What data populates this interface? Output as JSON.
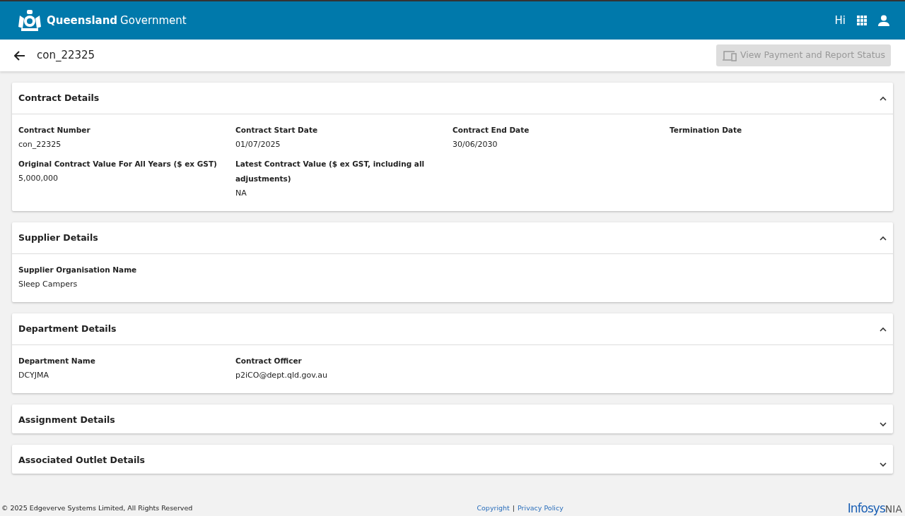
{
  "header": {
    "brand_bold": "Queensland",
    "brand_light": "Government",
    "greeting": "Hi"
  },
  "toolbar": {
    "title": "con_22325",
    "action": {
      "label": "View Payment and Report Status",
      "disabled": true
    }
  },
  "sections": [
    {
      "title": "Contract Details",
      "expanded": true,
      "fields": [
        {
          "label": "Contract Number",
          "value": "con_22325"
        },
        {
          "label": "Contract Start Date",
          "value": "01/07/2025"
        },
        {
          "label": "Contract End Date",
          "value": "30/06/2030"
        },
        {
          "label": "Termination Date"
        },
        {
          "label": "Original Contract Value For All Years ($ ex GST)",
          "value": "5,000,000"
        },
        {
          "label": "Latest Contract Value ($ ex GST, including all adjustments)",
          "value": "NA"
        }
      ]
    },
    {
      "title": "Supplier Details",
      "expanded": true,
      "fields": [
        {
          "label": "Supplier Organisation Name",
          "value": "Sleep Campers"
        }
      ]
    },
    {
      "title": "Department Details",
      "expanded": true,
      "fields": [
        {
          "label": "Department Name",
          "value": "DCYJMA"
        },
        {
          "label": "Contract Officer",
          "value": "p2iCO@dept.qld.gov.au"
        }
      ]
    },
    {
      "title": "Assignment Details",
      "expanded": false
    },
    {
      "title": "Associated Outlet Details",
      "expanded": false
    }
  ],
  "footer": {
    "copyright": "© 2025 Edgeverve Systems Limited, All Rights Reserved",
    "links": [
      "Copyright",
      "Privacy Policy"
    ],
    "separator": "|",
    "logo_main": "Infosys",
    "logo_sub": "NIA"
  }
}
